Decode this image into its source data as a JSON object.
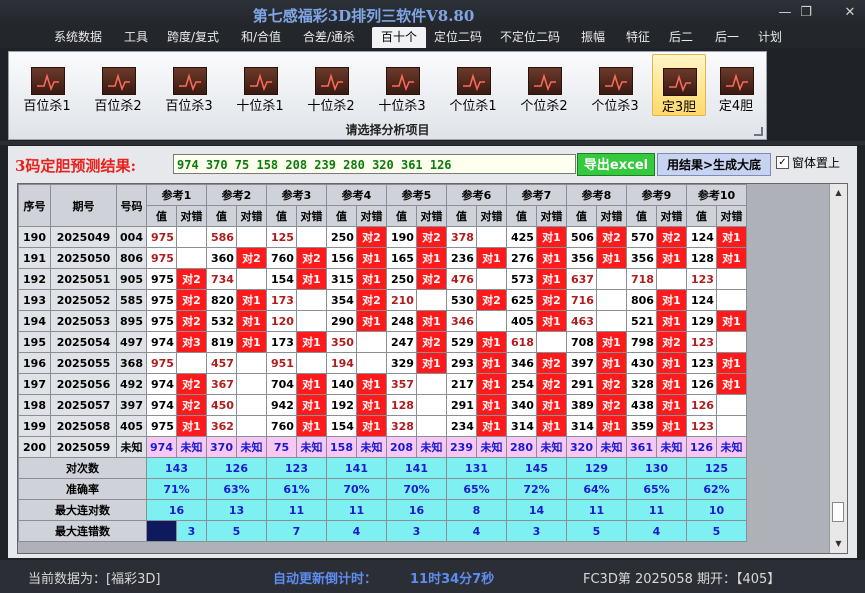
{
  "window": {
    "title": "第七感福彩3D排列三软件V8.80",
    "btn_min": "—",
    "btn_restore": "❐",
    "btn_close": "✕"
  },
  "menu": [
    "系统数据",
    "工具",
    "跨度/复式",
    "和/合值",
    "合差/通杀",
    "百十个",
    "定位二码",
    "不定位二码",
    "振幅",
    "特征",
    "后二",
    "后一",
    "计划"
  ],
  "menu_active": "百十个",
  "ribbon": {
    "buttons": [
      "百位杀1",
      "百位杀2",
      "百位杀3",
      "十位杀1",
      "十位杀2",
      "十位杀3",
      "个位杀1",
      "个位杀2",
      "个位杀3",
      "定3胆",
      "定4胆"
    ],
    "active": "定3胆",
    "caption": "请选择分析项目"
  },
  "result": {
    "label": "3码定胆预测结果:",
    "value": "974  370  75  158  208  239  280  320  361  126",
    "excel_button": "导出excel",
    "generate_button": "用结果>生成大底",
    "ontop_checked": "✓",
    "ontop_label": "窗体置上"
  },
  "table": {
    "headers": {
      "seq": "序号",
      "period": "期号",
      "number": "号码",
      "value": "值",
      "result": "对错"
    },
    "refs": [
      "参考1",
      "参考2",
      "参考3",
      "参考4",
      "参考5",
      "参考6",
      "参考7",
      "参考8",
      "参考9",
      "参考10"
    ],
    "rows": [
      {
        "seq": "190",
        "period": "2025049",
        "num": "004",
        "cells": [
          [
            "975",
            "",
            1
          ],
          [
            "586",
            "",
            1
          ],
          [
            "125",
            "",
            1
          ],
          [
            "250",
            "对2",
            0
          ],
          [
            "190",
            "对2",
            0
          ],
          [
            "378",
            "",
            1
          ],
          [
            "425",
            "对1",
            0
          ],
          [
            "506",
            "对2",
            0
          ],
          [
            "570",
            "对2",
            0
          ],
          [
            "124",
            "对1",
            0
          ]
        ]
      },
      {
        "seq": "191",
        "period": "2025050",
        "num": "806",
        "cells": [
          [
            "975",
            "",
            1
          ],
          [
            "360",
            "对2",
            0
          ],
          [
            "760",
            "对2",
            0
          ],
          [
            "156",
            "对1",
            0
          ],
          [
            "165",
            "对1",
            0
          ],
          [
            "236",
            "对1",
            0
          ],
          [
            "276",
            "对1",
            0
          ],
          [
            "356",
            "对1",
            0
          ],
          [
            "356",
            "对1",
            0
          ],
          [
            "128",
            "对1",
            0
          ]
        ]
      },
      {
        "seq": "192",
        "period": "2025051",
        "num": "905",
        "cells": [
          [
            "975",
            "对2",
            0
          ],
          [
            "734",
            "",
            1
          ],
          [
            "154",
            "对1",
            0
          ],
          [
            "315",
            "对1",
            0
          ],
          [
            "250",
            "对2",
            0
          ],
          [
            "476",
            "",
            1
          ],
          [
            "573",
            "对1",
            0
          ],
          [
            "637",
            "",
            1
          ],
          [
            "718",
            "",
            1
          ],
          [
            "123",
            "",
            1
          ]
        ]
      },
      {
        "seq": "193",
        "period": "2025052",
        "num": "585",
        "cells": [
          [
            "975",
            "对2",
            0
          ],
          [
            "820",
            "对1",
            0
          ],
          [
            "173",
            "",
            1
          ],
          [
            "354",
            "对2",
            0
          ],
          [
            "210",
            "",
            1
          ],
          [
            "530",
            "对2",
            0
          ],
          [
            "625",
            "对2",
            0
          ],
          [
            "716",
            "",
            1
          ],
          [
            "806",
            "对1",
            0
          ],
          [
            "124",
            "",
            0
          ]
        ]
      },
      {
        "seq": "194",
        "period": "2025053",
        "num": "895",
        "cells": [
          [
            "975",
            "对2",
            0
          ],
          [
            "532",
            "对1",
            0
          ],
          [
            "120",
            "",
            1
          ],
          [
            "290",
            "对1",
            0
          ],
          [
            "248",
            "对1",
            0
          ],
          [
            "346",
            "",
            1
          ],
          [
            "405",
            "对1",
            0
          ],
          [
            "463",
            "",
            1
          ],
          [
            "521",
            "对1",
            0
          ],
          [
            "129",
            "对1",
            0
          ]
        ]
      },
      {
        "seq": "195",
        "period": "2025054",
        "num": "497",
        "cells": [
          [
            "974",
            "对3",
            0
          ],
          [
            "819",
            "对1",
            0
          ],
          [
            "173",
            "对1",
            0
          ],
          [
            "350",
            "",
            1
          ],
          [
            "247",
            "对2",
            0
          ],
          [
            "529",
            "对1",
            0
          ],
          [
            "618",
            "",
            1
          ],
          [
            "708",
            "对1",
            0
          ],
          [
            "798",
            "对2",
            0
          ],
          [
            "123",
            "",
            1
          ]
        ]
      },
      {
        "seq": "196",
        "period": "2025055",
        "num": "368",
        "cells": [
          [
            "975",
            "",
            1
          ],
          [
            "457",
            "",
            1
          ],
          [
            "951",
            "",
            1
          ],
          [
            "194",
            "",
            1
          ],
          [
            "329",
            "对1",
            0
          ],
          [
            "293",
            "对1",
            0
          ],
          [
            "346",
            "对2",
            0
          ],
          [
            "397",
            "对1",
            0
          ],
          [
            "430",
            "对1",
            0
          ],
          [
            "123",
            "对1",
            0
          ]
        ]
      },
      {
        "seq": "197",
        "period": "2025056",
        "num": "492",
        "cells": [
          [
            "974",
            "对2",
            0
          ],
          [
            "367",
            "",
            1
          ],
          [
            "704",
            "对1",
            0
          ],
          [
            "140",
            "对1",
            0
          ],
          [
            "357",
            "",
            1
          ],
          [
            "217",
            "对1",
            0
          ],
          [
            "254",
            "对2",
            0
          ],
          [
            "291",
            "对2",
            0
          ],
          [
            "328",
            "对1",
            0
          ],
          [
            "126",
            "对1",
            0
          ]
        ]
      },
      {
        "seq": "198",
        "period": "2025057",
        "num": "397",
        "cells": [
          [
            "974",
            "对2",
            0
          ],
          [
            "450",
            "",
            1
          ],
          [
            "942",
            "对1",
            0
          ],
          [
            "192",
            "对1",
            0
          ],
          [
            "128",
            "",
            1
          ],
          [
            "291",
            "对1",
            0
          ],
          [
            "340",
            "对1",
            0
          ],
          [
            "389",
            "对2",
            0
          ],
          [
            "438",
            "对1",
            0
          ],
          [
            "126",
            "",
            1
          ]
        ]
      },
      {
        "seq": "199",
        "period": "2025058",
        "num": "405",
        "cells": [
          [
            "975",
            "对1",
            0
          ],
          [
            "362",
            "",
            1
          ],
          [
            "760",
            "对1",
            0
          ],
          [
            "154",
            "对1",
            0
          ],
          [
            "328",
            "",
            1
          ],
          [
            "234",
            "对1",
            0
          ],
          [
            "314",
            "对1",
            0
          ],
          [
            "314",
            "对1",
            0
          ],
          [
            "359",
            "对1",
            0
          ],
          [
            "123",
            "",
            1
          ]
        ]
      }
    ],
    "pending": {
      "seq": "200",
      "period": "2025059",
      "num": "未知",
      "values": [
        "974",
        "370",
        "75",
        "158",
        "208",
        "239",
        "280",
        "320",
        "361",
        "126"
      ],
      "result": "未知"
    },
    "stats": [
      {
        "label": "对次数",
        "values": [
          "143",
          "126",
          "123",
          "141",
          "141",
          "131",
          "145",
          "129",
          "130",
          "125"
        ]
      },
      {
        "label": "准确率",
        "values": [
          "71%",
          "63%",
          "61%",
          "70%",
          "70%",
          "65%",
          "72%",
          "64%",
          "65%",
          "62%"
        ]
      },
      {
        "label": "最大连对数",
        "values": [
          "16",
          "13",
          "11",
          "11",
          "16",
          "8",
          "14",
          "11",
          "11",
          "10"
        ]
      },
      {
        "label": "最大连错数",
        "values": [
          "3",
          "5",
          "7",
          "4",
          "3",
          "4",
          "3",
          "5",
          "4",
          "5"
        ]
      }
    ],
    "scroll_up": "▲",
    "scroll_down": "▼"
  },
  "status": {
    "current_data": "当前数据为：[福彩3D]",
    "countdown_label": "自动更新倒计时：",
    "countdown_value": "11时34分7秒",
    "period_info": "FC3D第 2025058 期开：【405】"
  },
  "colors": {
    "hit": "#ff1b1b",
    "pending": "#f7c8f3",
    "stats": "#7ff0f2",
    "title": "#7fa6e6"
  }
}
